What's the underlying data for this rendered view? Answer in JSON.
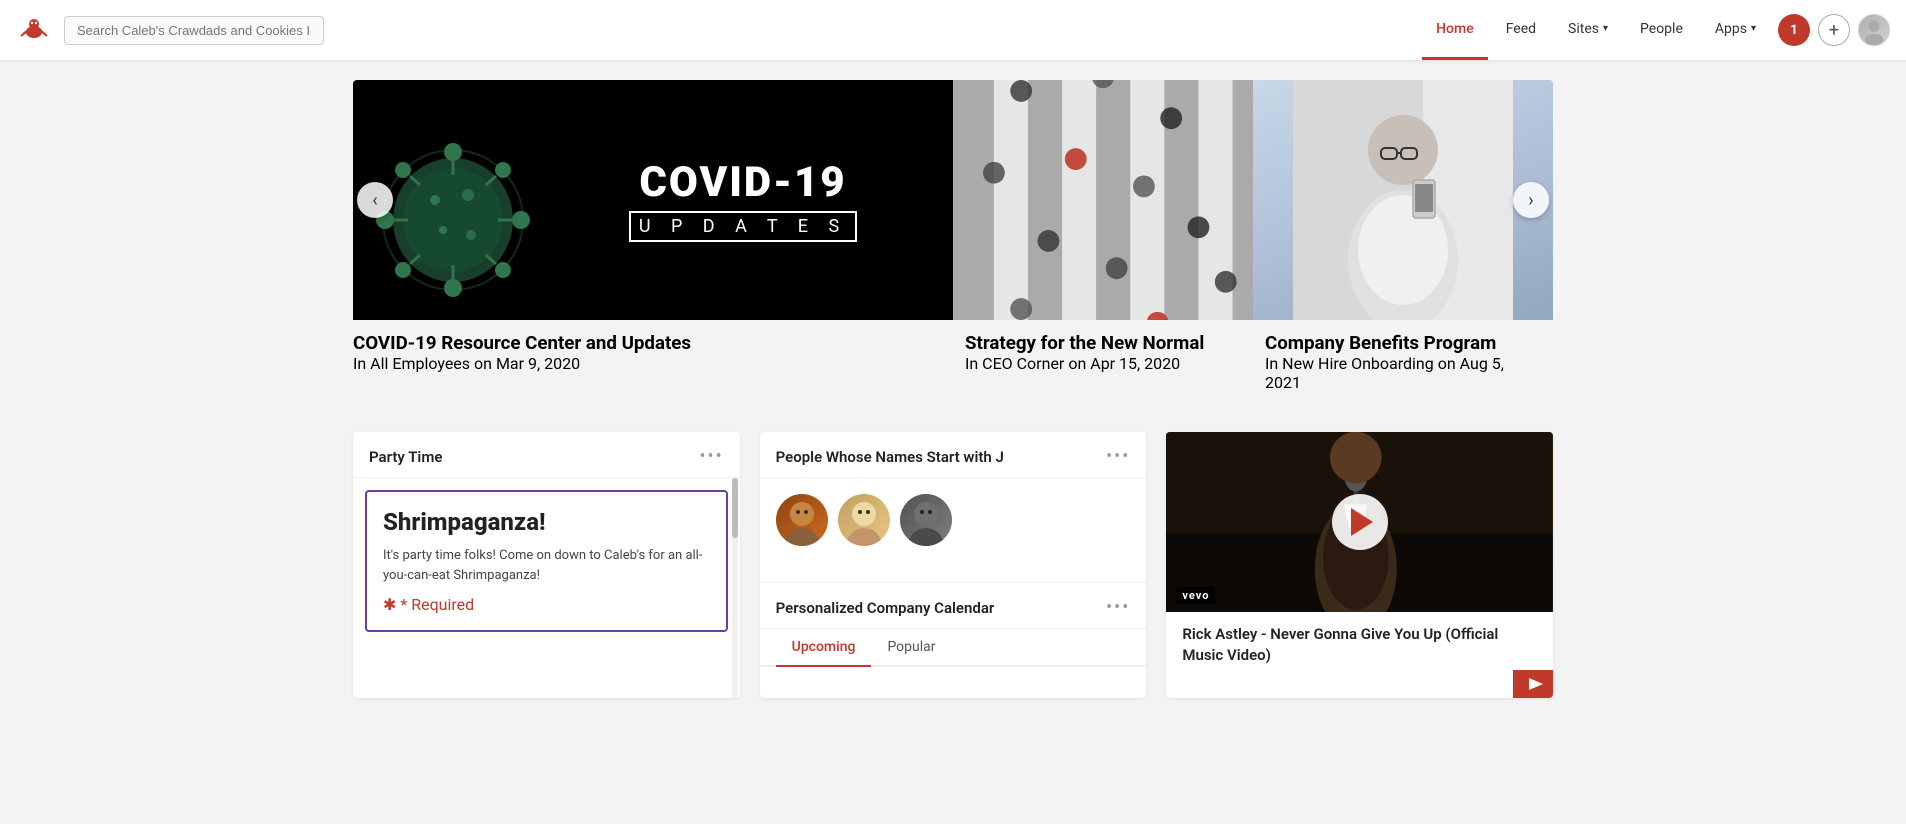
{
  "header": {
    "logo_alt": "Caleb's Crawdads Logo",
    "search_placeholder": "Search Caleb's Crawdads and Cookies Intran...",
    "nav_items": [
      {
        "id": "home",
        "label": "Home",
        "active": true
      },
      {
        "id": "feed",
        "label": "Feed",
        "active": false
      },
      {
        "id": "sites",
        "label": "Sites",
        "active": false,
        "has_dropdown": true
      },
      {
        "id": "people",
        "label": "People",
        "active": false
      },
      {
        "id": "apps",
        "label": "Apps",
        "active": false,
        "has_dropdown": true
      }
    ],
    "notification_count": "1",
    "add_btn_label": "+",
    "avatar_alt": "User Avatar"
  },
  "carousel": {
    "prev_label": "‹",
    "next_label": "›",
    "items": [
      {
        "id": "covid",
        "title": "COVID-19 Resource Center and Updates",
        "category": "All Employees",
        "date": "Mar 9, 2020",
        "image_type": "covid"
      },
      {
        "id": "strategy",
        "title": "Strategy for the New Normal",
        "category": "CEO Corner",
        "date": "Apr 15, 2020",
        "image_type": "crowd"
      },
      {
        "id": "benefits",
        "title": "Company Benefits Program",
        "category": "New Hire Onboarding",
        "date": "Aug 5, 2021",
        "image_type": "woman"
      }
    ],
    "in_label": "In",
    "on_label": "on"
  },
  "widgets": {
    "party_time": {
      "title": "Party Time",
      "menu_label": "•••",
      "card": {
        "heading": "Shrimpaganza!",
        "body": "It's party time folks! Come on down to Caleb's for an all-you-can-eat Shrimpaganza!",
        "required_label": "* Required"
      }
    },
    "people_j": {
      "title": "People Whose Names Start with J",
      "menu_label": "•••",
      "avatars": [
        {
          "id": "j1",
          "color1": "#8B5E3C",
          "color2": "#C68642"
        },
        {
          "id": "j2",
          "color1": "#C4A265",
          "color2": "#EDD9A3"
        },
        {
          "id": "j3",
          "color1": "#4a4a4a",
          "color2": "#888888"
        }
      ]
    },
    "calendar": {
      "title": "Personalized Company Calendar",
      "menu_label": "•••",
      "tabs": [
        {
          "id": "upcoming",
          "label": "Upcoming",
          "active": true
        },
        {
          "id": "popular",
          "label": "Popular",
          "active": false
        }
      ]
    },
    "video": {
      "title": "Rick Astley - Never Gonna Give You Up (Official Music Video)",
      "vevo_label": "vevo",
      "menu_label": "•••"
    }
  }
}
